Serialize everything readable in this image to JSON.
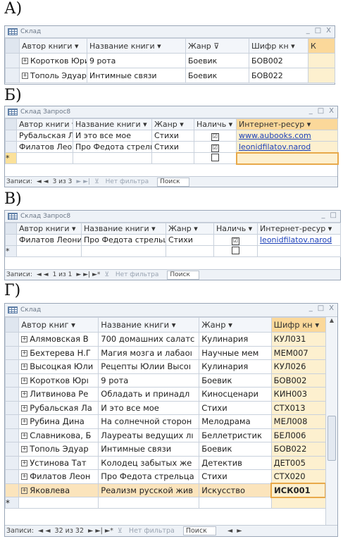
{
  "sections": [
    {
      "letter": "А)",
      "window_title": "Склад",
      "columns": [
        "Автор книги",
        "Название книги",
        "Жанр",
        "Шифр кн",
        "К"
      ],
      "rows": [
        [
          "Коротков Юри",
          "9 рота",
          "Боевик",
          "БОВ002"
        ],
        [
          "Тополь Эдуард",
          "Интимные связи",
          "Боевик",
          "БОВ022"
        ]
      ]
    },
    {
      "letter": "Б)",
      "window_title": "Склад Запрос8",
      "columns": [
        "Автор книги",
        "Название книги",
        "Жанр",
        "Наличь",
        "Интернет-ресур"
      ],
      "rows": [
        [
          "Рубальская Ла",
          "И это все мое",
          "Стихи",
          "☑",
          "www.aubooks.com"
        ],
        [
          "Филатов Леони",
          "Про Федота стрельца",
          "Стихи",
          "☑",
          "leonidfilatov.narod"
        ]
      ],
      "nav": {
        "label": "Записи:",
        "position": "3 из 3",
        "filter": "Нет фильтра",
        "search": "Поиск"
      }
    },
    {
      "letter": "В)",
      "window_title": "Склад Запрос8",
      "columns": [
        "Автор книги",
        "Название книги",
        "Жанр",
        "Наличь",
        "Интернет-ресур"
      ],
      "rows": [
        [
          "Филатов Леони",
          "Про Федота стрельца",
          "Стихи",
          "☑",
          "leonidfilatov.narod"
        ]
      ],
      "nav": {
        "label": "Записи:",
        "position": "1 из 1",
        "filter": "Нет фильтра",
        "search": "Поиск"
      }
    },
    {
      "letter": "Г)",
      "window_title": "Склад",
      "columns": [
        "Автор книг",
        "Название книги",
        "Жанр",
        "Шифр кн"
      ],
      "rows": [
        [
          "Алямовская В",
          "700 домашних салатс",
          "Кулинария",
          "КУЛ031"
        ],
        [
          "Бехтерева Н.Г",
          "Магия мозга и лабаоı",
          "Научные мем",
          "МЕМ007"
        ],
        [
          "Высоцкая Юли",
          "Рецепты Юлии Высоı",
          "Кулинария",
          "КУЛ026"
        ],
        [
          "Коротков Юрı",
          "9 рота",
          "Боевик",
          "БОВ002"
        ],
        [
          "Литвинова Ре",
          "Обладать и принадл",
          "Киносценари",
          "КИН003"
        ],
        [
          "Рубальская Ла",
          "И это все мое",
          "Стихи",
          "СТХ013"
        ],
        [
          "Рубина Дина",
          "На солнечной сторон",
          "Мелодрама",
          "МЕЛ008"
        ],
        [
          "Славникова, Б",
          "Лауреаты ведущих лı",
          "Беллетристик",
          "БЕЛ006"
        ],
        [
          "Тополь Эдуар",
          "Интимные связи",
          "Боевик",
          "БОВ022"
        ],
        [
          "Устинова Тат",
          "Колодец забытых же",
          "Детектив",
          "ДЕТ005"
        ],
        [
          "Филатов Леон",
          "Про Федота стрельца",
          "Стихи",
          "СТХ020"
        ],
        [
          "Яковлева",
          "Реализм русской жив",
          "Искусство",
          "ИСК001"
        ]
      ],
      "nav": {
        "label": "Записи:",
        "position": "32 из 32",
        "filter": "Нет фильтра",
        "search": "Поиск"
      }
    }
  ]
}
